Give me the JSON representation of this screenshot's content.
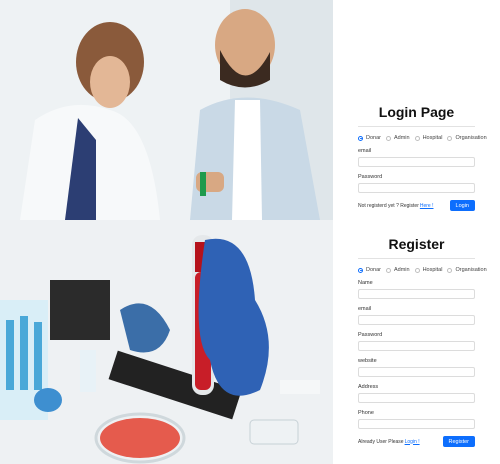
{
  "images": {
    "top": "lab-scientists-photo",
    "bottom": "blood-sample-tube-photo"
  },
  "login": {
    "title": "Login Page",
    "roles": [
      "Donar",
      "Admin",
      "Hospital",
      "Organisation"
    ],
    "selected_role": "Donar",
    "email_label": "email",
    "password_label": "Password",
    "footer_text": "Not registerd yet ? Register",
    "footer_link": "Here !",
    "button_label": "Login"
  },
  "register": {
    "title": "Register",
    "roles": [
      "Donar",
      "Admin",
      "Hospital",
      "Organisation"
    ],
    "selected_role": "Donar",
    "name_label": "Name",
    "email_label": "email",
    "password_label": "Password",
    "website_label": "website",
    "address_label": "Address",
    "phone_label": "Phone",
    "footer_text": "Already User Please",
    "footer_link": "Login !",
    "button_label": "Register"
  },
  "colors": {
    "accent": "#0d6efd"
  }
}
